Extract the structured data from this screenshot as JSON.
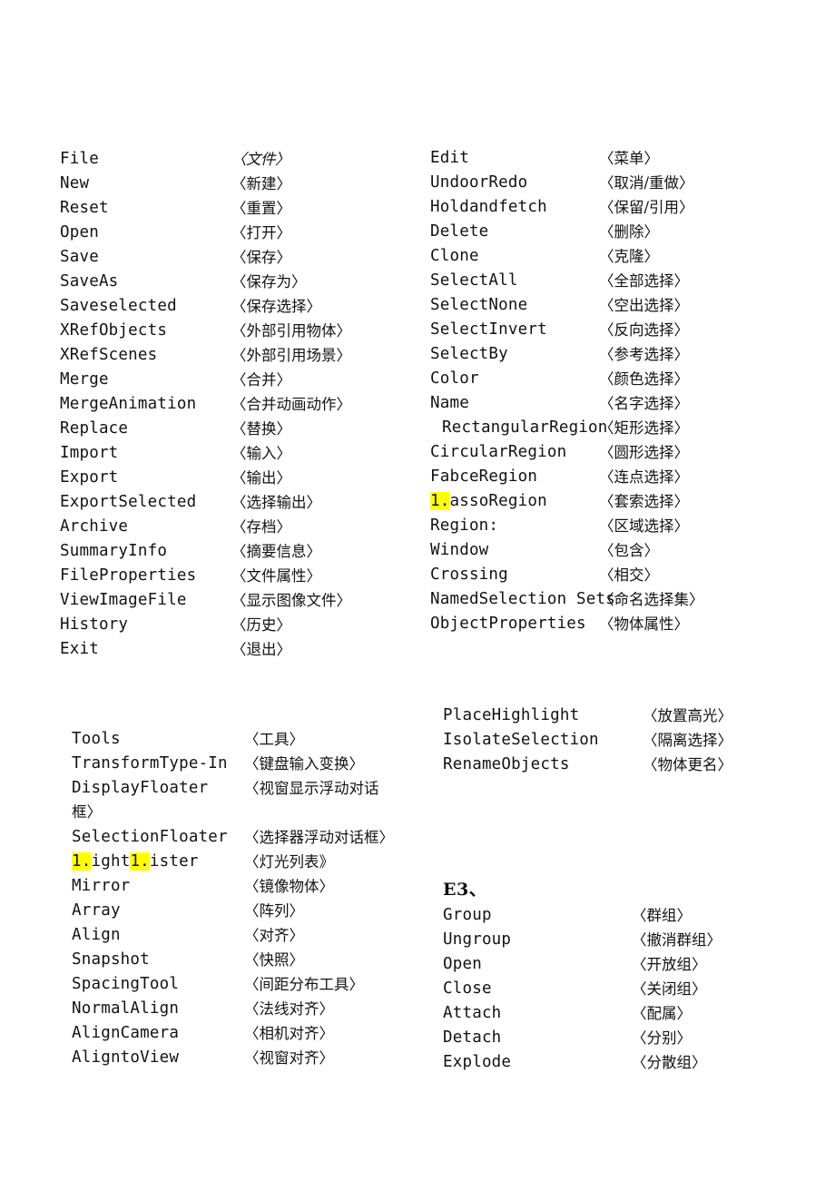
{
  "document": {
    "kind": "scanned-glossary-page",
    "background_color": "#ffffff",
    "text_color": "#121212",
    "highlight_color": "#ffff00"
  },
  "file_menu": {
    "rows": [
      {
        "en": "File",
        "zh": "〈文件〉",
        "style": "italic"
      },
      {
        "en": "New",
        "zh": "〈新建〉"
      },
      {
        "en": "Reset",
        "zh": "〈重置〉"
      },
      {
        "en": "Open",
        "zh": "〈打开〉"
      },
      {
        "en": "Save",
        "zh": "〈保存〉"
      },
      {
        "en": "SaveAs",
        "zh": "〈保存为〉"
      },
      {
        "en": "Saveselected",
        "zh": "〈保存选择〉"
      },
      {
        "en": "XRefObjects",
        "zh": "〈外部引用物体〉"
      },
      {
        "en": "XRefScenes",
        "zh": "〈外部引用场景〉"
      },
      {
        "en": "Merge",
        "zh": "〈合并〉"
      },
      {
        "en": "MergeAnimation",
        "zh": "〈合并动画动作〉"
      },
      {
        "en": "Replace",
        "zh": "〈替换〉"
      },
      {
        "en": "Import",
        "zh": "〈输入〉"
      },
      {
        "en": "Export",
        "zh": "〈输出〉"
      },
      {
        "en": "ExportSelected",
        "zh": "〈选择输出〉"
      },
      {
        "en": "Archive",
        "zh": "〈存档〉"
      },
      {
        "en": "SummaryInfo",
        "zh": "〈摘要信息〉"
      },
      {
        "en": "FileProperties",
        "zh": "〈文件属性〉"
      },
      {
        "en": "ViewImageFile",
        "zh": "〈显示图像文件〉"
      },
      {
        "en": "History",
        "zh": "〈历史〉"
      },
      {
        "en": "Exit",
        "zh": "〈退出〉"
      }
    ]
  },
  "edit_menu": {
    "rows": [
      {
        "en": "Edit",
        "zh": "〈菜单〉"
      },
      {
        "en": "UndoorRedo",
        "zh": "〈取消/重做〉"
      },
      {
        "en": "Holdandfetch",
        "zh": "〈保留/引用〉"
      },
      {
        "en": "Delete",
        "zh": "〈删除〉"
      },
      {
        "en": "Clone",
        "zh": "〈克隆〉"
      },
      {
        "en": "SelectAll",
        "zh": "〈全部选择〉"
      },
      {
        "en": "SelectNone",
        "zh": "〈空出选择〉"
      },
      {
        "en": "SelectInvert",
        "zh": "〈反向选择〉"
      },
      {
        "en": "SelectBy",
        "zh": "〈参考选择〉"
      },
      {
        "en": "Color",
        "zh": "〈颜色选择〉"
      },
      {
        "en": "Name",
        "zh": "〈名字选择〉"
      },
      {
        "en": "RectangularRegion",
        "zh": "〈矩形选择〉",
        "indent": true
      },
      {
        "en": "CircularRegion",
        "zh": "〈圆形选择〉"
      },
      {
        "en": "FabceRegion",
        "zh": "〈连点选择〉"
      },
      {
        "en": "assoRegion",
        "zh": "〈套索选择〉",
        "prefix_highlight": "1."
      },
      {
        "en": "Region:",
        "zh": "〈区域选择〉"
      },
      {
        "en": "Window",
        "zh": "〈包含〉"
      },
      {
        "en": "Crossing",
        "zh": "〈相交〉"
      },
      {
        "en": "NamedSelection    Sets",
        "zh": "〈命名选择集〉"
      },
      {
        "en": "ObjectProperties",
        "zh": "〈物体属性〉"
      }
    ]
  },
  "display_menu": {
    "rows": [
      {
        "en": "PlaceHighlight",
        "zh": "〈放置高光〉"
      },
      {
        "en": "IsolateSelection",
        "zh": "〈隔离选择〉"
      },
      {
        "en": "RenameObjects",
        "zh": "〈物体更名〉"
      }
    ]
  },
  "tools_menu": {
    "rows": [
      {
        "en": "Tools",
        "zh": "〈工具〉"
      },
      {
        "en": "TransformType-In",
        "zh": "〈键盘输入变换〉"
      },
      {
        "en": "DisplayFloater",
        "zh": "〈视窗显示浮动对话",
        "wrap_tail": "框〉"
      },
      {
        "en": "SelectionFloater",
        "zh": "〈选择器浮动对话框〉"
      },
      {
        "en": "ightister",
        "zh": "〈灯光列表》",
        "split_highlight": [
          "1.",
          "ight",
          "1.",
          "ister"
        ]
      },
      {
        "en": "Mirror",
        "zh": "〈镜像物体〉"
      },
      {
        "en": "Array",
        "zh": "〈阵列〉"
      },
      {
        "en": "Align",
        "zh": "〈对齐〉"
      },
      {
        "en": "Snapshot",
        "zh": "〈快照〉"
      },
      {
        "en": "SpacingTool",
        "zh": "〈间距分布工具〉"
      },
      {
        "en": "NormalAlign",
        "zh": "〈法线对齐〉"
      },
      {
        "en": "AlignCamera",
        "zh": "〈相机对齐〉"
      },
      {
        "en": "AligntoView",
        "zh": "〈视窗对齐〉"
      }
    ]
  },
  "group_menu": {
    "heading": "E3、",
    "rows": [
      {
        "en": "Group",
        "zh": "〈群组〉"
      },
      {
        "en": "Ungroup",
        "zh": "〈撤消群组〉"
      },
      {
        "en": "Open",
        "zh": "〈开放组〉"
      },
      {
        "en": "Close",
        "zh": "〈关闭组〉"
      },
      {
        "en": "Attach",
        "zh": "〈配属〉"
      },
      {
        "en": "Detach",
        "zh": "〈分别〉"
      },
      {
        "en": "Explode",
        "zh": "〈分散组〉"
      }
    ]
  }
}
